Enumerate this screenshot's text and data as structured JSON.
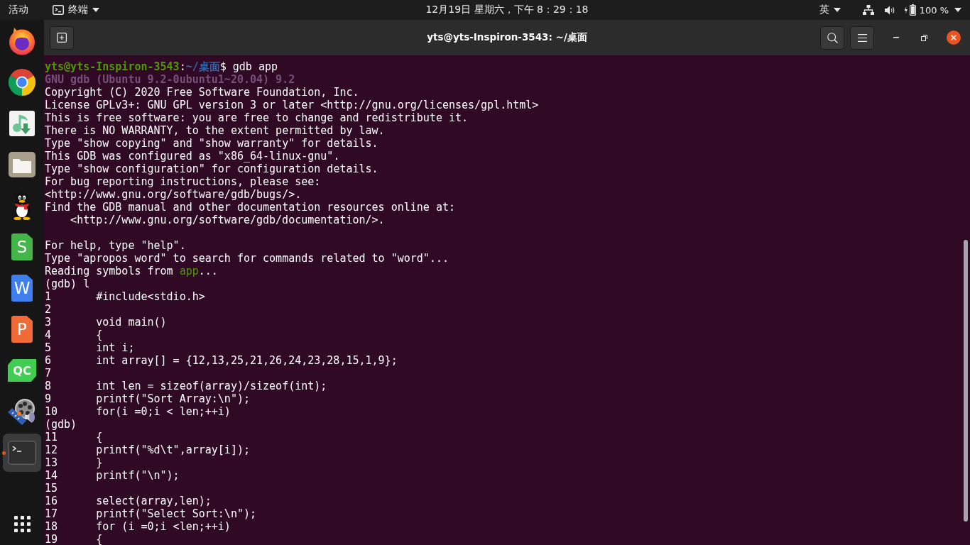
{
  "top_bar": {
    "activities": "活动",
    "app_menu": "终端",
    "clock": "12月19日 星期六，下午 8：29：18",
    "input_method": "英",
    "battery": "100 %"
  },
  "dock": {
    "items": [
      {
        "kind": "flame-globe",
        "active": false,
        "running": false
      },
      {
        "kind": "color-ring",
        "active": false,
        "running": false
      },
      {
        "kind": "music",
        "active": false,
        "running": false
      },
      {
        "kind": "folder",
        "active": false,
        "running": false
      },
      {
        "kind": "penguin",
        "active": false,
        "running": false
      },
      {
        "kind": "sheet",
        "glyph": "S",
        "active": false,
        "running": false
      },
      {
        "kind": "writer",
        "glyph": "W",
        "active": false,
        "running": false
      },
      {
        "kind": "slides",
        "glyph": "P",
        "active": false,
        "running": false
      },
      {
        "kind": "qc",
        "glyph": "QC",
        "active": false,
        "running": false
      },
      {
        "kind": "film",
        "active": false,
        "running": false
      },
      {
        "kind": "terminal",
        "active": true,
        "running": true
      }
    ]
  },
  "terminal": {
    "title": "yts@yts-Inspiron-3543: ~/桌面",
    "lines": [
      {
        "kind": "prompt",
        "user_host": "yts@yts-Inspiron-3543",
        "separator": ":",
        "path": "~/桌面",
        "command": "$ gdb app"
      },
      {
        "kind": "banner",
        "text": "GNU gdb (Ubuntu 9.2-0ubuntu1~20.04) 9.2"
      },
      {
        "kind": "output",
        "text": "Copyright (C) 2020 Free Software Foundation, Inc."
      },
      {
        "kind": "output",
        "text": "License GPLv3+: GNU GPL version 3 or later <http://gnu.org/licenses/gpl.html>"
      },
      {
        "kind": "output",
        "text": "This is free software: you are free to change and redistribute it."
      },
      {
        "kind": "output",
        "text": "There is NO WARRANTY, to the extent permitted by law."
      },
      {
        "kind": "output",
        "text": "Type \"show copying\" and \"show warranty\" for details."
      },
      {
        "kind": "output",
        "text": "This GDB was configured as \"x86_64-linux-gnu\"."
      },
      {
        "kind": "output",
        "text": "Type \"show configuration\" for configuration details."
      },
      {
        "kind": "output",
        "text": "For bug reporting instructions, please see:"
      },
      {
        "kind": "output",
        "text": "<http://www.gnu.org/software/gdb/bugs/>."
      },
      {
        "kind": "output",
        "text": "Find the GDB manual and other documentation resources online at:"
      },
      {
        "kind": "indented",
        "text": "<http://www.gnu.org/software/gdb/documentation/>."
      },
      {
        "kind": "blank"
      },
      {
        "kind": "output",
        "text": "For help, type \"help\"."
      },
      {
        "kind": "output",
        "text": "Type \"apropos word\" to search for commands related to \"word\"..."
      },
      {
        "kind": "reading",
        "text": "Reading symbols from ",
        "file": "app",
        "suffix": "..."
      },
      {
        "kind": "output",
        "text": "(gdb) l"
      },
      {
        "kind": "listing",
        "line_no": "1",
        "code": "#include<stdio.h>"
      },
      {
        "kind": "listing",
        "line_no": "2"
      },
      {
        "kind": "listing",
        "line_no": "3",
        "code": "void main()"
      },
      {
        "kind": "listing",
        "line_no": "4",
        "code": "{"
      },
      {
        "kind": "listing",
        "line_no": "5",
        "code": "int i;"
      },
      {
        "kind": "listing",
        "line_no": "6",
        "code": "int array[] = {12,13,25,21,26,24,23,28,15,1,9};"
      },
      {
        "kind": "listing",
        "line_no": "7"
      },
      {
        "kind": "listing",
        "line_no": "8",
        "code": "int len = sizeof(array)/sizeof(int);"
      },
      {
        "kind": "listing",
        "line_no": "9",
        "code": "printf(\"Sort Array:\\n\");"
      },
      {
        "kind": "listing",
        "line_no": "10",
        "code": "for(i =0;i < len;++i)"
      },
      {
        "kind": "output",
        "text": "(gdb)"
      },
      {
        "kind": "listing",
        "line_no": "11",
        "code": "{"
      },
      {
        "kind": "listing",
        "line_no": "12",
        "code": "printf(\"%d\\t\",array[i]);"
      },
      {
        "kind": "listing",
        "line_no": "13",
        "code": "}"
      },
      {
        "kind": "listing",
        "line_no": "14",
        "code": "printf(\"\\n\");"
      },
      {
        "kind": "listing",
        "line_no": "15"
      },
      {
        "kind": "listing",
        "line_no": "16",
        "code": "select(array,len);"
      },
      {
        "kind": "listing",
        "line_no": "17",
        "code": "printf(\"Select Sort:\\n\");"
      },
      {
        "kind": "listing",
        "line_no": "18",
        "code": "for (i =0;i <len;++i)"
      },
      {
        "kind": "listing",
        "line_no": "19",
        "code": "{"
      }
    ]
  }
}
